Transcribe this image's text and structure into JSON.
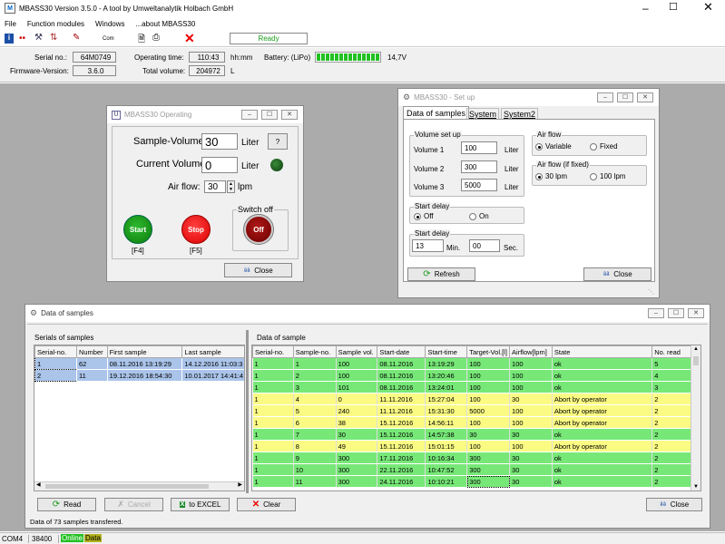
{
  "app": {
    "title": "MBASS30 Version 3.5.0  - A tool by Umweltanalytik Holbach GmbH"
  },
  "menu": [
    "File",
    "Function modules",
    "Windows",
    "...about MBASS30"
  ],
  "toolbar": {
    "ready": "Ready",
    "com_label": "Com"
  },
  "info": {
    "serial_label": "Serial no.:",
    "serial": "64M0749",
    "firmware_label": "Firmware-Version:",
    "firmware": "3.6.0",
    "optime_label": "Operating time:",
    "optime": "110:43",
    "optime_unit": "hh:mm",
    "totvol_label": "Total volume:",
    "totvol": "204972",
    "totvol_unit": "L",
    "battery_label": "Battery: (LiPo)",
    "battery_value": "14,7V",
    "battery_level": 1.0
  },
  "operating": {
    "title": "MBASS30  Operating",
    "sample_vol_label": "Sample-Volume:",
    "sample_vol": "30",
    "sample_vol_unit": "Liter",
    "help": "?",
    "current_vol_label": "Current Volume:",
    "current_vol": "0",
    "current_vol_unit": "Liter",
    "airflow_label": "Air flow:",
    "airflow": "30",
    "airflow_unit": "lpm",
    "start": "Start",
    "start_key": "[F4]",
    "stop": "Stop",
    "stop_key": "[F5]",
    "switch_off_label": "Switch off",
    "off": "Off",
    "close": "Close"
  },
  "setup": {
    "title": "MBASS30 - Set up",
    "tabs": [
      "Data of samples",
      "System",
      "System2"
    ],
    "volume_group": "Volume set up",
    "vol1_label": "Volume 1",
    "vol1": "100",
    "vol2_label": "Volume 2",
    "vol2": "300",
    "vol3_label": "Volume 3",
    "vol3": "5000",
    "liter": "Liter",
    "start_delay_group": "Start delay",
    "off": "Off",
    "on": "On",
    "start_delay2_group": "Start delay",
    "min_value": "13",
    "min_label": "Min.",
    "sec_value": "00",
    "sec_label": "Sec.",
    "airflow_group": "Air flow",
    "variable": "Variable",
    "fixed": "Fixed",
    "airflow_fixed_group": "Air flow (if fixed)",
    "lpm30": "30 lpm",
    "lpm100": "100 lpm",
    "refresh": "Refresh",
    "close": "Close"
  },
  "samples": {
    "title": "Data of samples",
    "serials_title": "Serials of samples",
    "serials_headers": [
      "Serial-no.",
      "Number",
      "First sample",
      "Last sample"
    ],
    "serials": [
      [
        "1",
        "62",
        "08.11.2016 13:19:29",
        "14.12.2016 11:03:3"
      ],
      [
        "2",
        "11",
        "19.12.2016 18:54:30",
        "10.01.2017 14:41:4"
      ]
    ],
    "data_title": "Data of sample",
    "headers": [
      "Serial-no.",
      "Sample-no.",
      "Sample vol.",
      "Start-date",
      "Start-time",
      "Target-Vol.[l]",
      "Airflow[lpm]",
      "State",
      "No. read"
    ],
    "rows": [
      [
        "1",
        "1",
        "100",
        "08.11.2016",
        "13:19:29",
        "100",
        "100",
        "ok",
        "5"
      ],
      [
        "1",
        "2",
        "100",
        "08.11.2016",
        "13:20:46",
        "100",
        "100",
        "ok",
        "4"
      ],
      [
        "1",
        "3",
        "101",
        "08.11.2016",
        "13:24:01",
        "100",
        "100",
        "ok",
        "3"
      ],
      [
        "1",
        "4",
        "0",
        "11.11.2016",
        "15:27:04",
        "100",
        "30",
        "Abort by operator",
        "2"
      ],
      [
        "1",
        "5",
        "240",
        "11.11.2016",
        "15:31:30",
        "5000",
        "100",
        "Abort by operator",
        "2"
      ],
      [
        "1",
        "6",
        "38",
        "15.11.2016",
        "14:56:11",
        "100",
        "100",
        "Abort by operator",
        "2"
      ],
      [
        "1",
        "7",
        "30",
        "15.11.2016",
        "14:57:38",
        "30",
        "30",
        "ok",
        "2"
      ],
      [
        "1",
        "8",
        "49",
        "15.11.2016",
        "15:01:15",
        "100",
        "100",
        "Abort by operator",
        "2"
      ],
      [
        "1",
        "9",
        "300",
        "17.11.2016",
        "10:16:34",
        "300",
        "30",
        "ok",
        "2"
      ],
      [
        "1",
        "10",
        "300",
        "22.11.2016",
        "10:47:52",
        "300",
        "30",
        "ok",
        "2"
      ],
      [
        "1",
        "11",
        "300",
        "24.11.2016",
        "10:10:21",
        "300",
        "30",
        "ok",
        "2"
      ]
    ],
    "row_kinds": [
      "g",
      "g",
      "g",
      "y",
      "y",
      "y",
      "g",
      "y",
      "g",
      "g",
      "g"
    ],
    "read": "Read",
    "cancel": "Cancel",
    "excel": "to EXCEL",
    "clear": "Clear",
    "close": "Close",
    "status": "Data of 73 samples transfered."
  },
  "statusbar": {
    "port": "COM4",
    "baud": "38400",
    "online": "Online",
    "data": "Data"
  },
  "colors": {
    "green": "#77e877",
    "yellow": "#fbfb84",
    "sel": "#aac4ea"
  }
}
